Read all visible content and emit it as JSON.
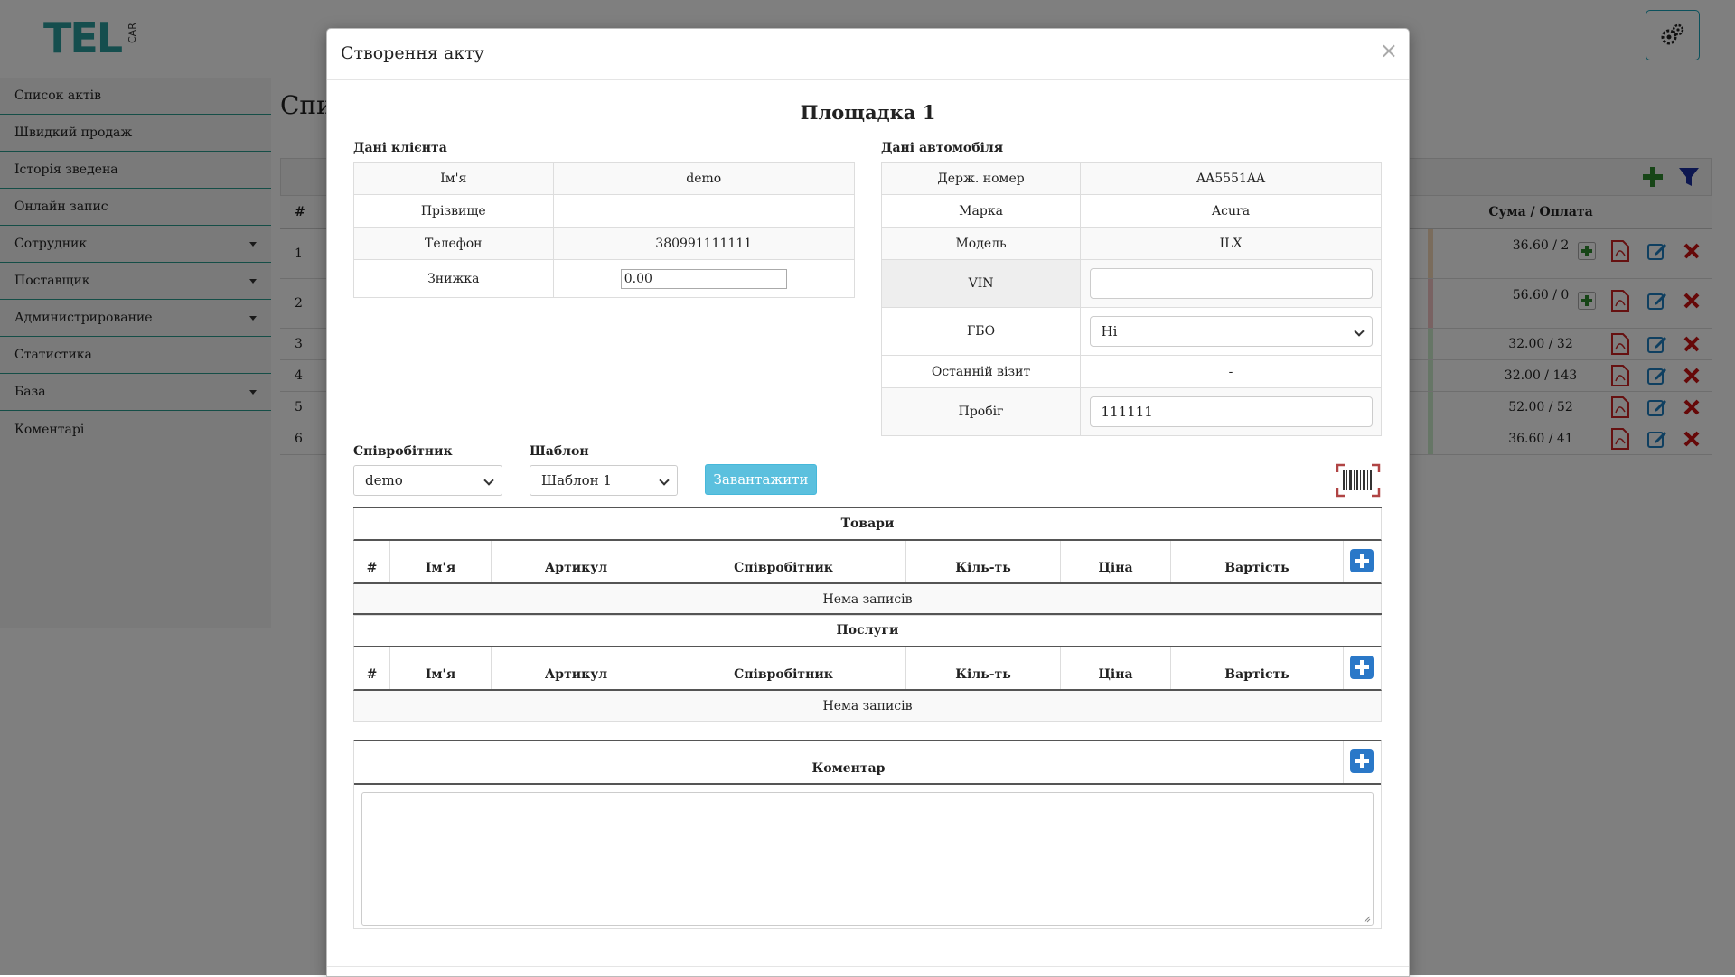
{
  "app": {
    "logo_text": "TEL CAR",
    "page_heading_partial": "Спи",
    "sidebar": {
      "items": [
        {
          "label": "Список актів",
          "dropdown": false
        },
        {
          "label": "Швидкий продаж",
          "dropdown": false
        },
        {
          "label": "Історія зведена",
          "dropdown": false
        },
        {
          "label": "Онлайн запис",
          "dropdown": false
        },
        {
          "label": "Сотрудник",
          "dropdown": true
        },
        {
          "label": "Поставщик",
          "dropdown": true
        },
        {
          "label": "Администрирование",
          "dropdown": true
        },
        {
          "label": "Статистика",
          "dropdown": false
        },
        {
          "label": "База",
          "dropdown": true
        },
        {
          "label": "Коментарі",
          "dropdown": false
        }
      ]
    },
    "background_table": {
      "col_number": "#",
      "col_sum": "Сума / Оплата",
      "rows": [
        {
          "n": "1",
          "sum": "36.60 / 2",
          "status_color": "#f5d9b8"
        },
        {
          "n": "2",
          "sum": "56.60 / 0",
          "status_color": "#f2c4c4"
        },
        {
          "n": "3",
          "sum": "32.00 / 32",
          "status_color": "#cdeccd"
        },
        {
          "n": "4",
          "sum": "32.00 / 143",
          "status_color": "#cdeccd"
        },
        {
          "n": "5",
          "sum": "52.00 / 52",
          "status_color": "#cdeccd"
        },
        {
          "n": "6",
          "sum": "36.60 / 41",
          "status_color": "#cdeccd"
        }
      ]
    }
  },
  "modal": {
    "title": "Створення акту",
    "close": "×",
    "site_title": "Площадка 1",
    "client": {
      "section_label": "Дані клієнта",
      "name_label": "Ім'я",
      "name_value": "demo",
      "surname_label": "Прізвище",
      "surname_value": "",
      "phone_label": "Телефон",
      "phone_value": "380991111111",
      "discount_label": "Знижка",
      "discount_value": "0.00"
    },
    "car": {
      "section_label": "Дані автомобіля",
      "plate_label": "Держ. номер",
      "plate_value": "AA5551AA",
      "brand_label": "Марка",
      "brand_value": "Acura",
      "model_label": "Модель",
      "model_value": "ILX",
      "vin_label": "VIN",
      "vin_value": "",
      "gas_label": "ГБО",
      "gas_value": "Ні",
      "last_visit_label": "Останній візит",
      "last_visit_value": "-",
      "mileage_label": "Пробіг",
      "mileage_value": "111111"
    },
    "employee_label": "Співробітник",
    "employee_value": "demo",
    "template_label": "Шаблон",
    "template_value": "Шаблон 1",
    "upload_button": "Завантажити",
    "goods": {
      "title": "Товари",
      "columns": [
        "#",
        "Ім'я",
        "Артикул",
        "Співробітник",
        "Кіль-ть",
        "Ціна",
        "Вартість"
      ],
      "empty": "Нема записів"
    },
    "services": {
      "title": "Послуги",
      "columns": [
        "#",
        "Ім'я",
        "Артикул",
        "Співробітник",
        "Кіль-ть",
        "Ціна",
        "Вартість"
      ],
      "empty": "Нема записів"
    },
    "comment": {
      "title": "Коментар",
      "value": ""
    }
  },
  "colors": {
    "accent_teal": "#17a2b8",
    "info_button": "#5bc0de",
    "add_blue": "#2a78c8",
    "delete_red": "#cc1111",
    "pdf_red": "#cc2222",
    "add_green": "#2e8b2e"
  }
}
